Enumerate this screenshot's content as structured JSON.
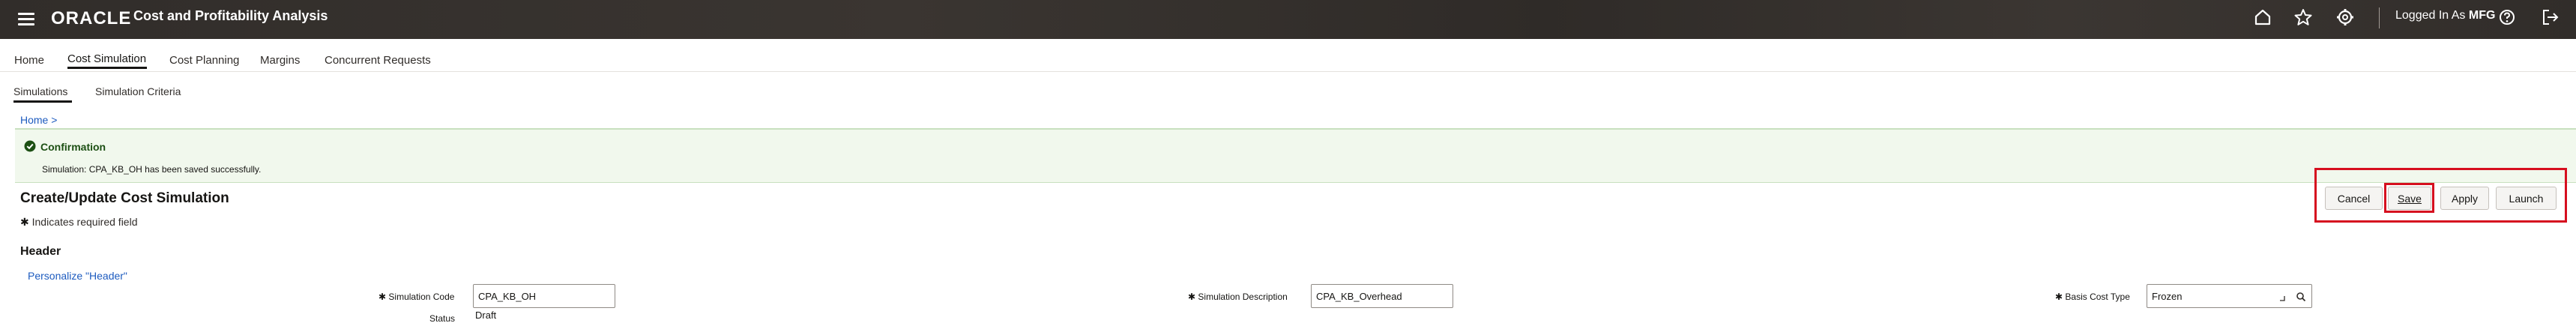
{
  "header": {
    "brand": "ORACLE",
    "app_title": "Cost and Profitability Analysis",
    "logged_in_prefix": "Logged In As",
    "user": "MFG",
    "icons": [
      "menu-icon",
      "home-icon",
      "star-icon",
      "gear-icon",
      "help-icon",
      "logout-icon"
    ]
  },
  "nav": {
    "tabs": [
      {
        "label": "Home"
      },
      {
        "label": "Cost Simulation"
      },
      {
        "label": "Cost Planning"
      },
      {
        "label": "Margins"
      },
      {
        "label": "Concurrent Requests"
      }
    ],
    "active": "Cost Simulation"
  },
  "subnav": {
    "tabs": [
      {
        "label": "Simulations"
      },
      {
        "label": "Simulation Criteria"
      }
    ],
    "active": "Simulations"
  },
  "breadcrumb": "Home >",
  "confirmation": {
    "title": "Confirmation",
    "message": "Simulation: CPA_KB_OH has been saved successfully."
  },
  "page": {
    "title": "Create/Update Cost Simulation",
    "required_note": "Indicates required field",
    "required_marker": "✱"
  },
  "buttons": {
    "cancel": "Cancel",
    "save": "Save",
    "apply": "Apply",
    "launch": "Launch"
  },
  "section": {
    "title": "Header",
    "personalize": "Personalize \"Header\""
  },
  "fields": {
    "simulation_code": {
      "label": "Simulation Code",
      "value": "CPA_KB_OH"
    },
    "simulation_description": {
      "label": "Simulation Description",
      "value": "CPA_KB_Overhead"
    },
    "basis_cost_type": {
      "label": "Basis Cost Type",
      "value": "Frozen"
    },
    "status": {
      "label": "Status",
      "value": "Draft"
    }
  },
  "colors": {
    "header_bg": "#312d2a",
    "link": "#1d5bbf",
    "confirm_bg": "#f1f8ed",
    "confirm_text": "#1c4f13",
    "highlight": "#d60f1f"
  }
}
